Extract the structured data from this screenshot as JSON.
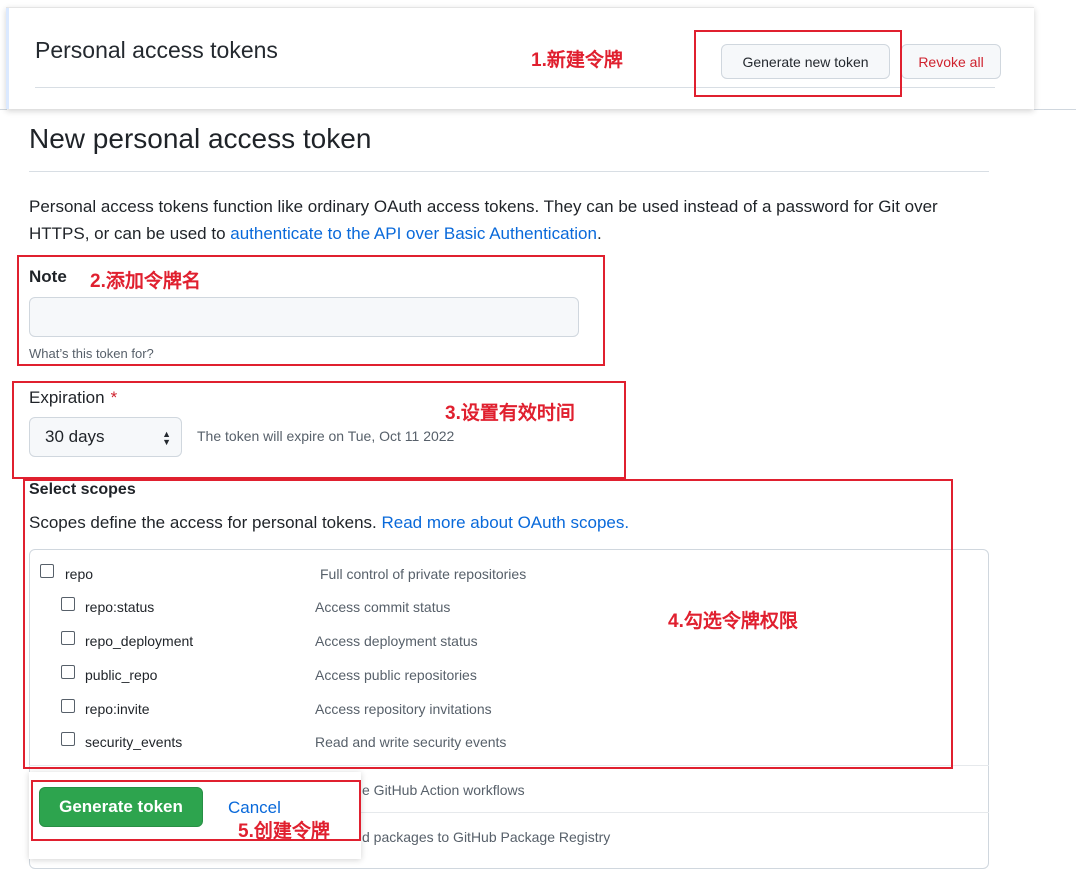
{
  "header": {
    "title": "Personal access tokens",
    "generate_new_token": "Generate new token",
    "revoke_all": "Revoke all"
  },
  "page": {
    "title": "New personal access token",
    "intro_text": "Personal access tokens function like ordinary OAuth access tokens. They can be used instead of a password for Git over HTTPS, or can be used to ",
    "intro_link": "authenticate to the API over Basic Authentication",
    "intro_end": "."
  },
  "note": {
    "label": "Note",
    "value": "",
    "placeholder": "",
    "hint": "What’s this token for?"
  },
  "expiration": {
    "label": "Expiration",
    "required_mark": "*",
    "selected": "30 days",
    "note": "The token will expire on Tue, Oct 11 2022"
  },
  "scopes": {
    "label": "Select scopes",
    "description": "Scopes define the access for personal tokens. ",
    "link": "Read more about OAuth scopes.",
    "items": [
      {
        "name": "repo",
        "desc": "Full control of private repositories",
        "checked": false
      },
      {
        "name": "repo:status",
        "desc": "Access commit status",
        "checked": false
      },
      {
        "name": "repo_deployment",
        "desc": "Access deployment status",
        "checked": false
      },
      {
        "name": "public_repo",
        "desc": "Access public repositories",
        "checked": false
      },
      {
        "name": "repo:invite",
        "desc": "Access repository invitations",
        "checked": false
      },
      {
        "name": "security_events",
        "desc": "Read and write security events",
        "checked": false
      }
    ],
    "partial_rows": [
      "e GitHub Action workflows",
      "d packages to GitHub Package Registry"
    ]
  },
  "footer": {
    "generate_token": "Generate token",
    "cancel": "Cancel"
  },
  "annotations": {
    "step1": "1.新建令牌",
    "step2": "2.添加令牌名",
    "step3": "3.设置有效时间",
    "step4": "4.勾选令牌权限",
    "step5": "5.创建令牌"
  },
  "colors": {
    "annotation": "#e0202f",
    "primary_button": "#2da44e",
    "link": "#0969da",
    "danger": "#cf222e"
  }
}
